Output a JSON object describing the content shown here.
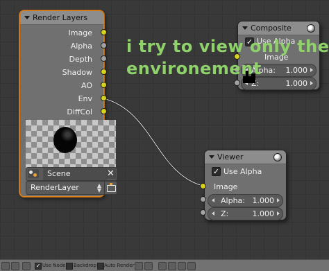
{
  "caption": {
    "line1": "i try to view only the",
    "line2": "environement",
    "color": "#8fd16a"
  },
  "render_layers_node": {
    "title": "Render Layers",
    "outputs": [
      "Image",
      "Alpha",
      "Depth",
      "Shadow",
      "AO",
      "Env",
      "DiffCol"
    ],
    "scene_label": "Scene",
    "layer_label": "RenderLayer",
    "selected_color": "#e0801a"
  },
  "composite_node": {
    "title": "Composite",
    "use_alpha_label": "Use Alpha",
    "use_alpha_checked": true,
    "image_label": "Image",
    "alpha_label": "Alpha:",
    "alpha_value": "1.000",
    "z_label": "Z:",
    "z_value": "1.000"
  },
  "viewer_node": {
    "title": "Viewer",
    "use_alpha_label": "Use Alpha",
    "use_alpha_checked": true,
    "image_label": "Image",
    "alpha_label": "Alpha:",
    "alpha_value": "1.000",
    "z_label": "Z:",
    "z_value": "1.000"
  },
  "footer": {
    "use_nodes_label": "Use Nodes",
    "backdrop_label": "Backdrop",
    "auto_render_label": "Auto Render"
  },
  "socket_colors": {
    "image": "#d9d31f",
    "value": "#a3a3a3"
  }
}
